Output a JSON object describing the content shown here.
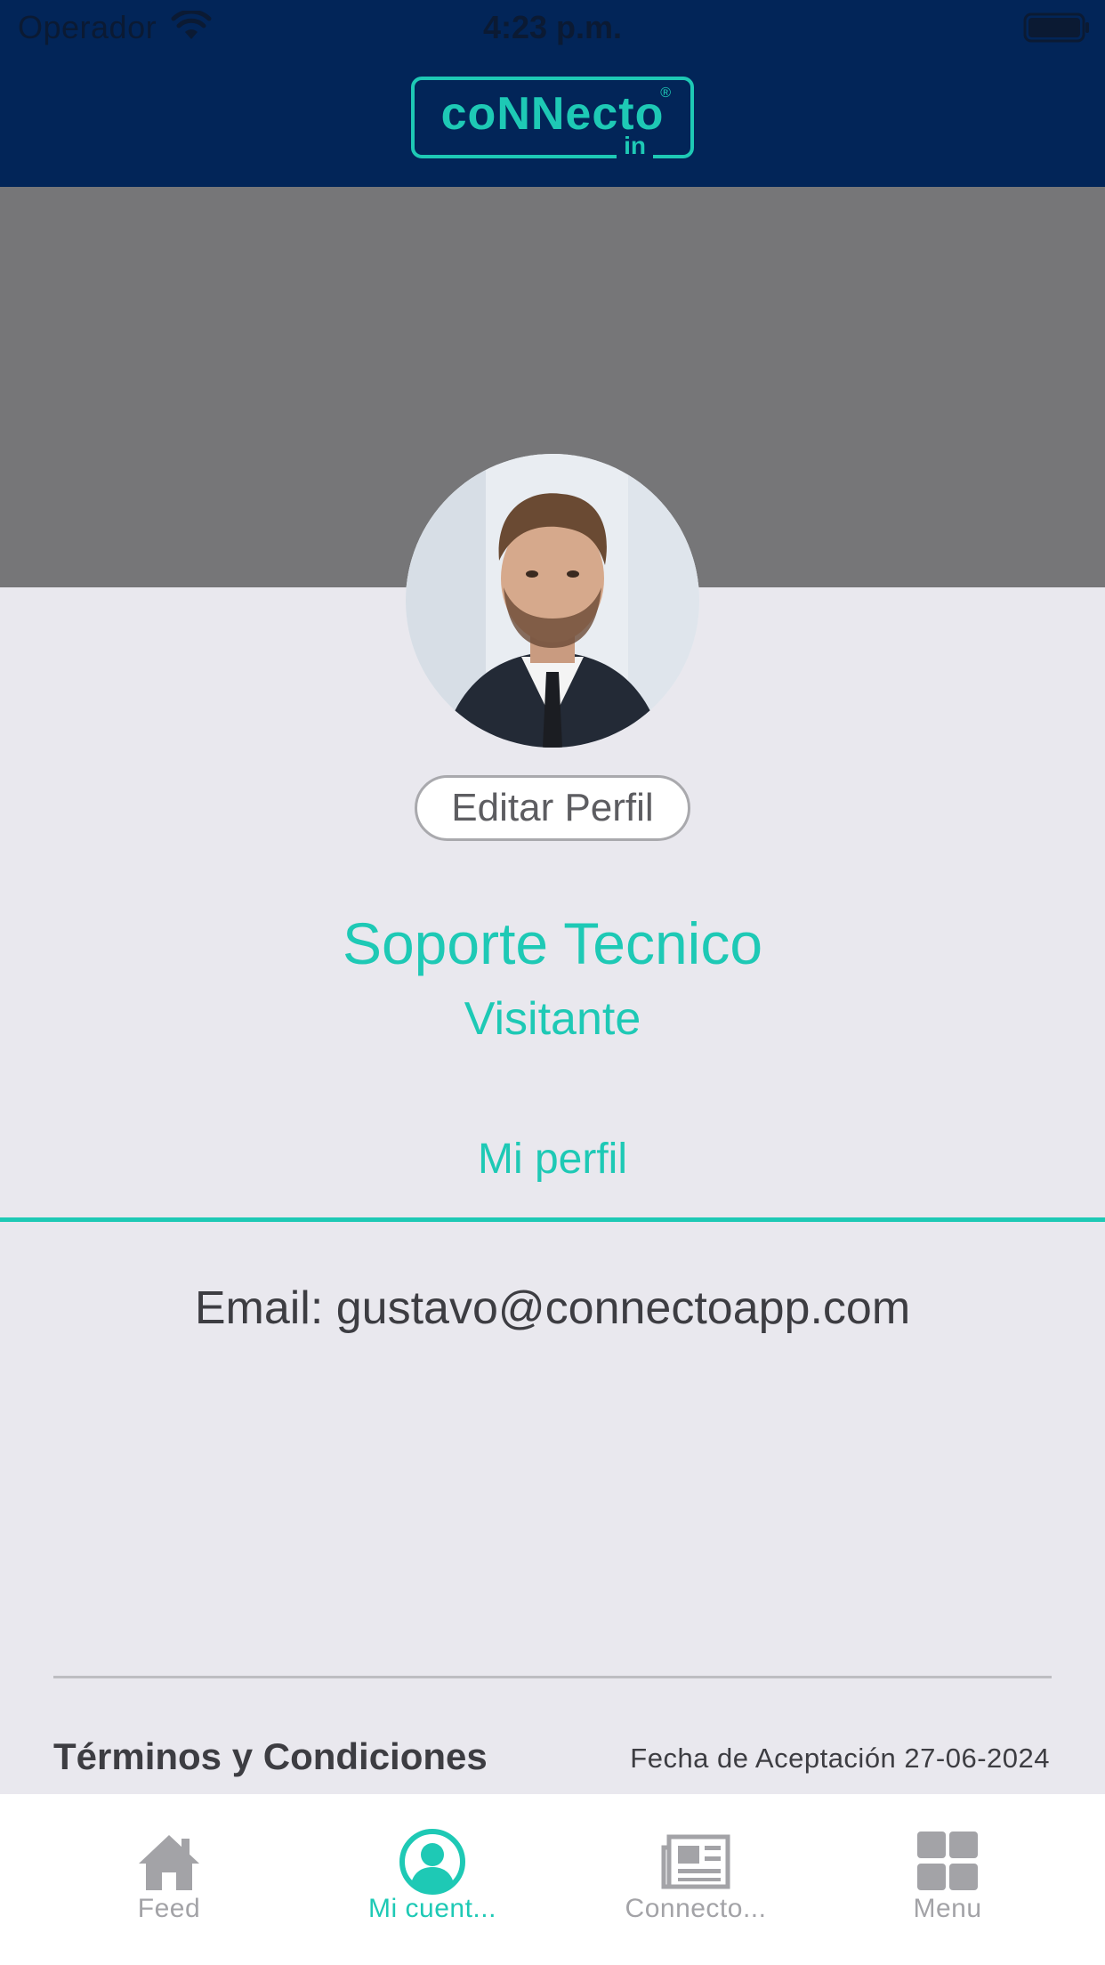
{
  "status_bar": {
    "carrier": "Operador",
    "time": "4:23 p.m."
  },
  "header": {
    "logo_text": "coNNecto",
    "logo_sub": "in",
    "logo_reg": "®"
  },
  "profile": {
    "edit_button": "Editar Perfil",
    "name": "Soporte Tecnico",
    "role": "Visitante",
    "tab_label": "Mi perfil",
    "email": "Email: gustavo@connectoapp.com"
  },
  "terms": {
    "label": "Términos y Condiciones",
    "date": "Fecha de Aceptación 27-06-2024"
  },
  "tab_bar": {
    "items": [
      {
        "label": "Feed",
        "icon": "home-icon",
        "active": false
      },
      {
        "label": "Mi cuent...",
        "icon": "user-icon",
        "active": true
      },
      {
        "label": "Connecto...",
        "icon": "newspaper-icon",
        "active": false
      },
      {
        "label": "Menu",
        "icon": "grid-icon",
        "active": false
      }
    ]
  },
  "colors": {
    "accent": "#1ec9b5",
    "nav_background": "#022558",
    "cover_background": "#767678",
    "page_background": "#e9e8ee",
    "inactive_tab": "#a3a3a7"
  }
}
